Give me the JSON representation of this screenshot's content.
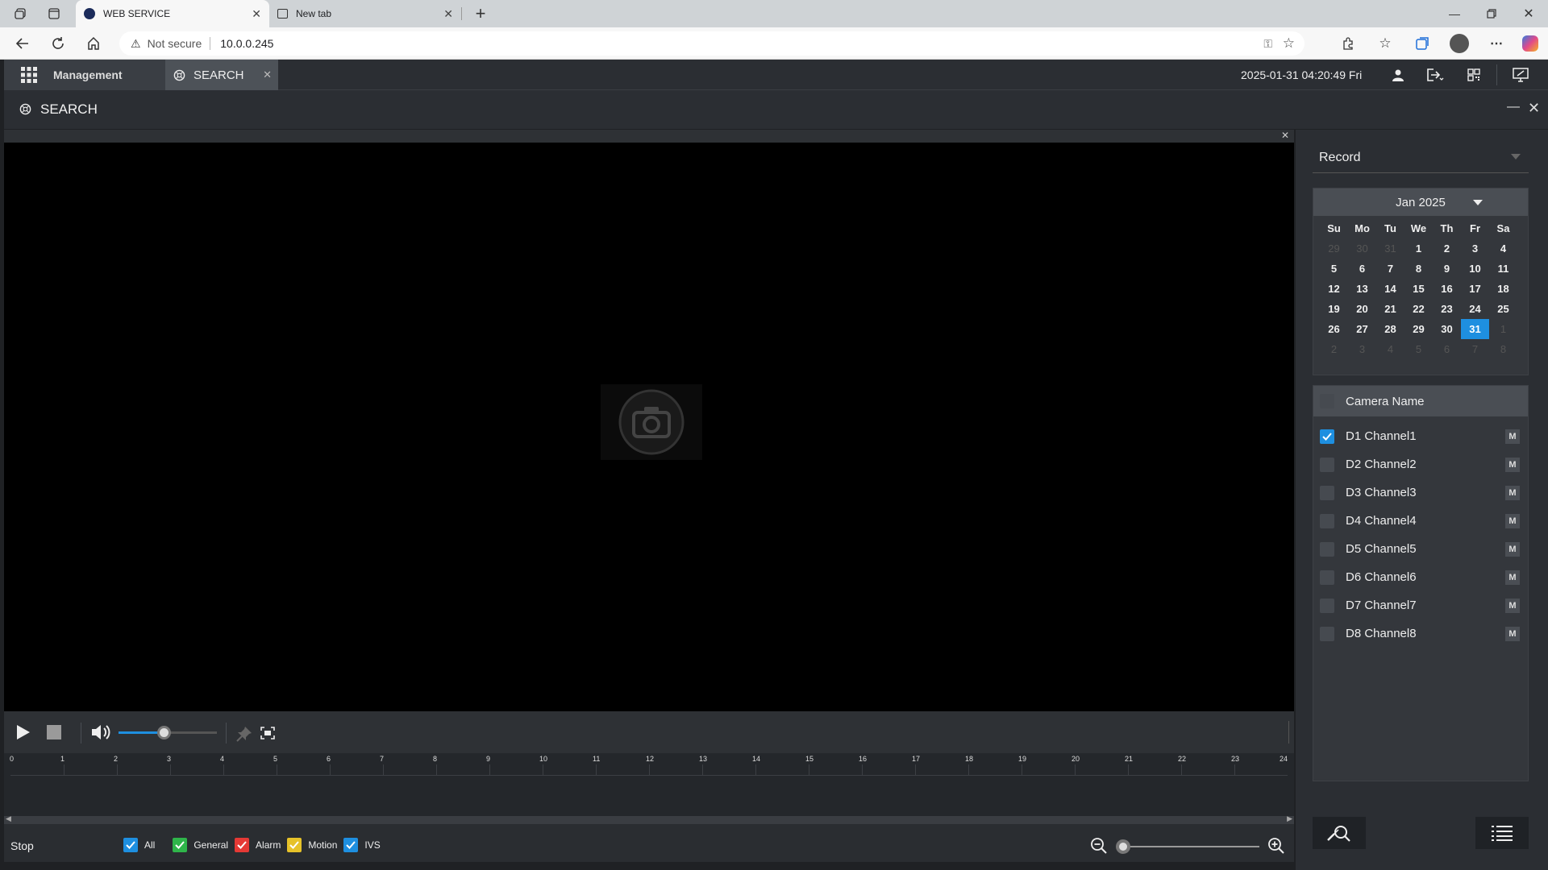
{
  "browser": {
    "tabs": [
      {
        "label": "WEB SERVICE",
        "active": true
      },
      {
        "label": "New tab",
        "active": false
      }
    ],
    "security_text": "Not secure",
    "url": "10.0.0.245"
  },
  "app": {
    "module_label": "Management",
    "open_tab_label": "SEARCH",
    "datetime": "2025-01-31 04:20:49 Fri",
    "page_title": "SEARCH"
  },
  "sidebar": {
    "record_type": "Record",
    "calendar": {
      "month_label": "Jan 2025",
      "weekdays": [
        "Su",
        "Mo",
        "Tu",
        "We",
        "Th",
        "Fr",
        "Sa"
      ],
      "weeks": [
        [
          "29",
          "30",
          "31",
          "1",
          "2",
          "3",
          "4"
        ],
        [
          "5",
          "6",
          "7",
          "8",
          "9",
          "10",
          "11"
        ],
        [
          "12",
          "13",
          "14",
          "15",
          "16",
          "17",
          "18"
        ],
        [
          "19",
          "20",
          "21",
          "22",
          "23",
          "24",
          "25"
        ],
        [
          "26",
          "27",
          "28",
          "29",
          "30",
          "31",
          "1"
        ],
        [
          "2",
          "3",
          "4",
          "5",
          "6",
          "7",
          "8"
        ]
      ],
      "selected_day": "31"
    },
    "camera_header": "Camera Name",
    "cameras": [
      {
        "name": "D1 Channel1",
        "checked": true,
        "badge": "M"
      },
      {
        "name": "D2 Channel2",
        "checked": false,
        "badge": "M"
      },
      {
        "name": "D3 Channel3",
        "checked": false,
        "badge": "M"
      },
      {
        "name": "D4 Channel4",
        "checked": false,
        "badge": "M"
      },
      {
        "name": "D5 Channel5",
        "checked": false,
        "badge": "M"
      },
      {
        "name": "D6 Channel6",
        "checked": false,
        "badge": "M"
      },
      {
        "name": "D7 Channel7",
        "checked": false,
        "badge": "M"
      },
      {
        "name": "D8 Channel8",
        "checked": false,
        "badge": "M"
      }
    ]
  },
  "player": {
    "volume_level": 0.5
  },
  "timeline": {
    "hour_ticks": [
      "0",
      "1",
      "2",
      "3",
      "4",
      "5",
      "6",
      "7",
      "8",
      "9",
      "10",
      "11",
      "12",
      "13",
      "14",
      "15",
      "16",
      "17",
      "18",
      "19",
      "20",
      "21",
      "22",
      "23",
      "24"
    ],
    "status": "Stop",
    "legend": [
      {
        "label": "All",
        "color": "#1e8fe0",
        "checked": true
      },
      {
        "label": "General",
        "color": "#2fb54a",
        "checked": true
      },
      {
        "label": "Alarm",
        "color": "#e53935",
        "checked": true
      },
      {
        "label": "Motion",
        "color": "#e6c229",
        "checked": true
      },
      {
        "label": "IVS",
        "color": "#1e8fe0",
        "checked": true
      }
    ],
    "zoom_level": 0.0
  }
}
